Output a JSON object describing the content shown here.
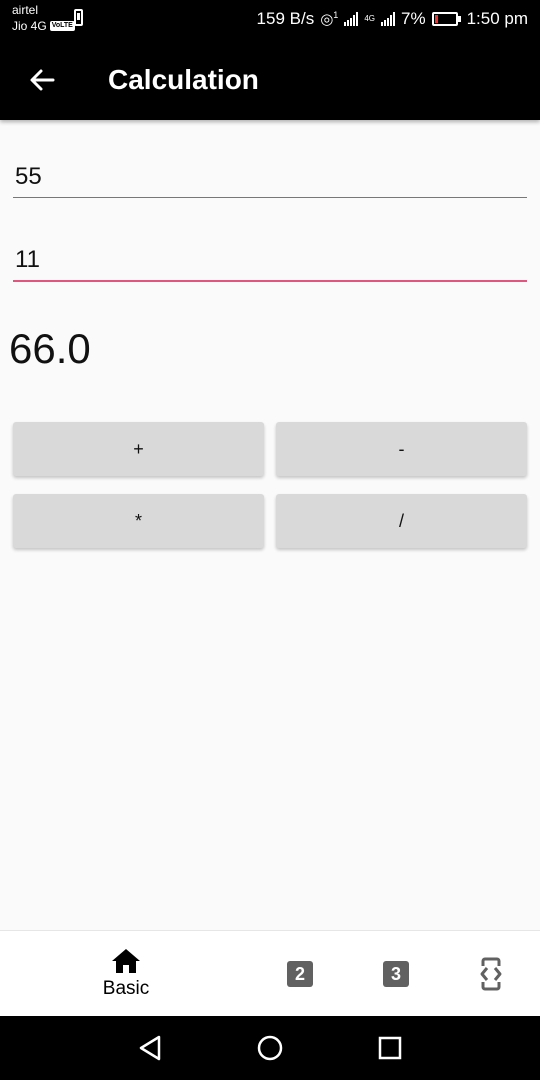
{
  "status_bar": {
    "carrier_1": "airtel",
    "carrier_2": "Jio 4G",
    "volte_badge": "VoLTE",
    "net_speed": "159 B/s",
    "hotspot_sup": "1",
    "lte_label": "4G",
    "battery_percent": "7%",
    "time": "1:50 pm"
  },
  "app_bar": {
    "title": "Calculation"
  },
  "form": {
    "first_number": "55",
    "second_number": "11"
  },
  "result": "66.0",
  "operations": {
    "add": "+",
    "subtract": "-",
    "multiply": "*",
    "divide": "/"
  },
  "bottom_nav": {
    "basic_label": "Basic",
    "tab2_icon": "2",
    "tab3_icon": "3"
  },
  "colors": {
    "app_bar": "#000000",
    "accent_underline": "#e1557e",
    "button_bg": "#d9d9d9",
    "background": "#fafafa"
  }
}
